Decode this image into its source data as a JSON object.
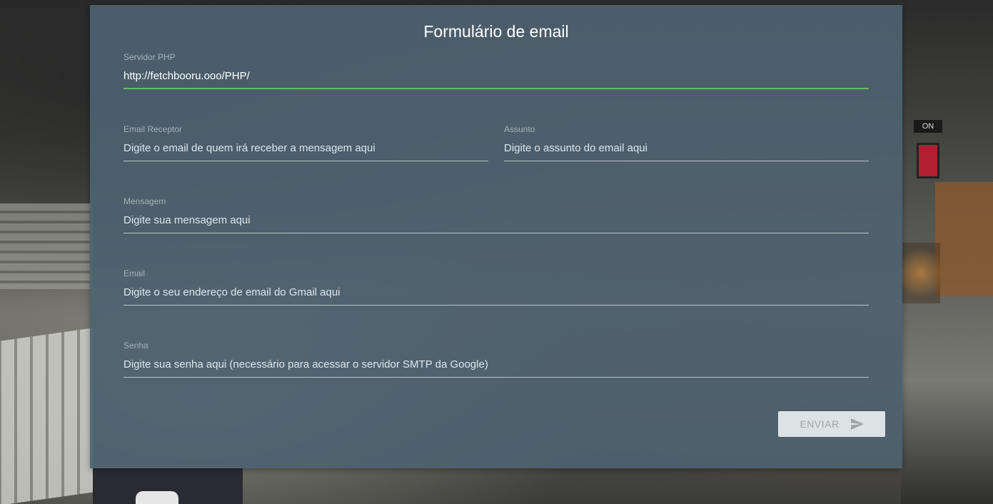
{
  "form": {
    "title": "Formulário de email",
    "php_server": {
      "label": "Servidor PHP",
      "value": "http://fetchbooru.ooo/PHP/"
    },
    "receptor": {
      "label": "Email Receptor",
      "placeholder": "Digite o email de quem irá receber a mensagem aqui"
    },
    "assunto": {
      "label": "Assunto",
      "placeholder": "Digite o assunto do email aqui"
    },
    "mensagem": {
      "label": "Mensagem",
      "placeholder": "Digite sua mensagem aqui"
    },
    "email": {
      "label": "Email",
      "placeholder": "Digite o seu endereço de email do Gmail aqui"
    },
    "senha": {
      "label": "Senha",
      "placeholder": "Digite sua senha aqui (necessário para acessar o servidor SMTP da Google)"
    },
    "send_button": {
      "label": "ENVIAR",
      "icon": "send-icon"
    }
  },
  "background": {
    "power_label": "ON"
  },
  "colors": {
    "active_underline": "#5cc060",
    "card": "#4e6270",
    "button_bg": "#dde2e5"
  }
}
